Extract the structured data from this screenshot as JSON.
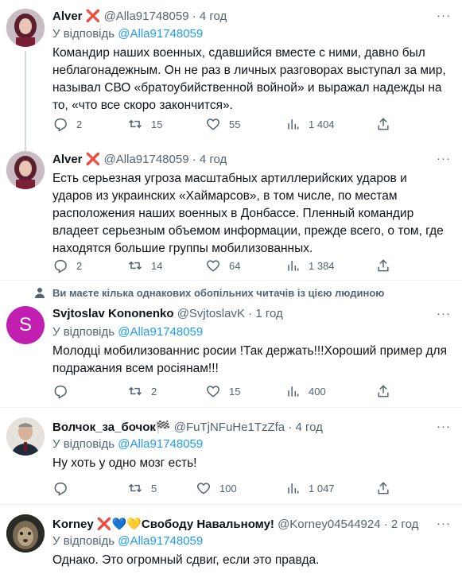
{
  "tweets": [
    {
      "name": "Alver",
      "handle": "@Alla91748059",
      "time": "4 год",
      "reply_prefix": "У відповідь",
      "reply_to": "@Alla91748059",
      "text": "Командир наших военных, сдавшийся вместе с ними, давно был неблагонадежным. Он не раз в личных разговорах выступал за мир, называл СВО «братоубийственной войной» и выражал надежды на то, «что все скоро закончится».",
      "replies": "2",
      "retweets": "15",
      "likes": "55",
      "views": "1 404"
    },
    {
      "name": "Alver",
      "handle": "@Alla91748059",
      "time": "4 год",
      "text": "Есть серьезная угроза масштабных артиллерийских ударов и ударов из украинских «Хаймарсов», в том числе, по местам расположения наших военных в Донбассе. Пленный командир владеет серьезным объемом информации, прежде всего, о том, где находятся большие группы мобилизованных.",
      "replies": "2",
      "retweets": "14",
      "likes": "64",
      "views": "1 384"
    },
    {
      "social_context": "Ви маєте кілька однакових обопільних читачів із цією людиною",
      "avatar_letter": "S",
      "name": "Svjtoslav Kononenko",
      "handle": "@SvjtoslavK",
      "time": "1 год",
      "reply_prefix": "У відповідь",
      "reply_to": "@Alla91748059",
      "text": "Молодці мобилизованнис росии !Так держать!!!Хороший пример для подражания всем росіянам!!!",
      "replies": "",
      "retweets": "2",
      "likes": "15",
      "views": "400"
    },
    {
      "name": "Волчок_за_бочок",
      "name_emoji": "🏁",
      "handle": "@FuTjNFuHe1TzZfa",
      "time": "4 год",
      "reply_prefix": "У відповідь",
      "reply_to": "@Alla91748059",
      "text": "Ну хоть у одно мозг есть!",
      "replies": "",
      "retweets": "5",
      "likes": "100",
      "views": "1 047"
    },
    {
      "name": "Korney",
      "name_emoji": "❌💙💛Свободу Навальному!",
      "handle": "@Korney04544924",
      "time": "2 год",
      "reply_prefix": "У відповідь",
      "reply_to": "@Alla91748059",
      "text": "Однако. Это огромный сдвиг, если это правда."
    }
  ],
  "dot": "·",
  "more_glyph": "···",
  "badge_glyph": "❌",
  "colors": {
    "link": "#1d9bf0",
    "muted": "#536471",
    "badge": "#e0245e",
    "avatar_s": "#c21fb0"
  }
}
